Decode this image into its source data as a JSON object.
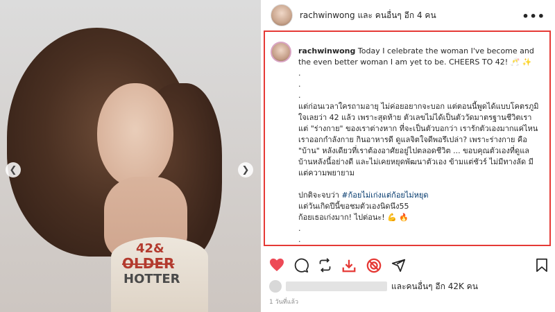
{
  "header": {
    "username_line": "rachwinwong และ คนอื่นๆ อีก 4 คน",
    "more_icon": "more-horizontal-icon"
  },
  "photo": {
    "cake_line1": "42&",
    "cake_line2": "OLDER",
    "cake_line3": "HOTTER"
  },
  "caption": {
    "username": "rachwinwong",
    "lines": [
      "Today I celebrate the woman I've become and the even better woman I am yet to be. CHEERS TO 42! 🥂 ✨",
      ".",
      ".",
      ".",
      "แต่ก่อนเวลาใครถามอายุ ไม่ค่อยอยากจะบอก แต่ตอนนี้พูดได้แบบโคตรภูมิใจเลยว่า 42 แล้ว เพราะสุดท้าย ตัวเลขไม่ได้เป็นตัววัดมาตรฐานชีวิตเรา แต่ \"ร่างกาย\" ของเราต่างหาก ที่จะเป็นตัวบอกว่า เรารักตัวเองมากแค่ไหน เราออกกำลังกาย กินอาหารดี ดูแลจิตใจดีพอรึเปล่า? เพราะร่างกาย คือ \"บ้าน\" หลังเดียวที่เราต้องอาศัยอยู่ไปตลอดชีวิต ... ขอบคุณตัวเองที่ดูแลบ้านหลังนี้อย่างดี และไม่เคยหยุดพัฒนาตัวเอง ข้ามแต่ชัวร์ ไม่มีทางลัด มีแต่ความพยายาม",
      "",
      "ปกติจะจบว่า",
      "แต่วันเกิดปีนี้ขอชมตัวเองนิดนึง55",
      "ก้อยเธอเก่งมาก! ไปต่อนะ! 💪 🔥",
      ".",
      "."
    ],
    "hashtag": "#ก้อยไม่เก่งแต่ก้อยไม่หยุด"
  },
  "actions": {
    "like_icon": "heart-filled-icon",
    "comment_icon": "comment-icon",
    "repost_icon": "repost-icon",
    "download_icon": "download-icon",
    "extension_icon": "extension-icon",
    "share_icon": "share-icon",
    "save_icon": "bookmark-icon",
    "accent_color": "#ed4956",
    "download_color": "#e53935"
  },
  "likes": {
    "text": "และคนอื่นๆ อีก 42K คน"
  },
  "timestamp": "1 วันที่แล้ว"
}
